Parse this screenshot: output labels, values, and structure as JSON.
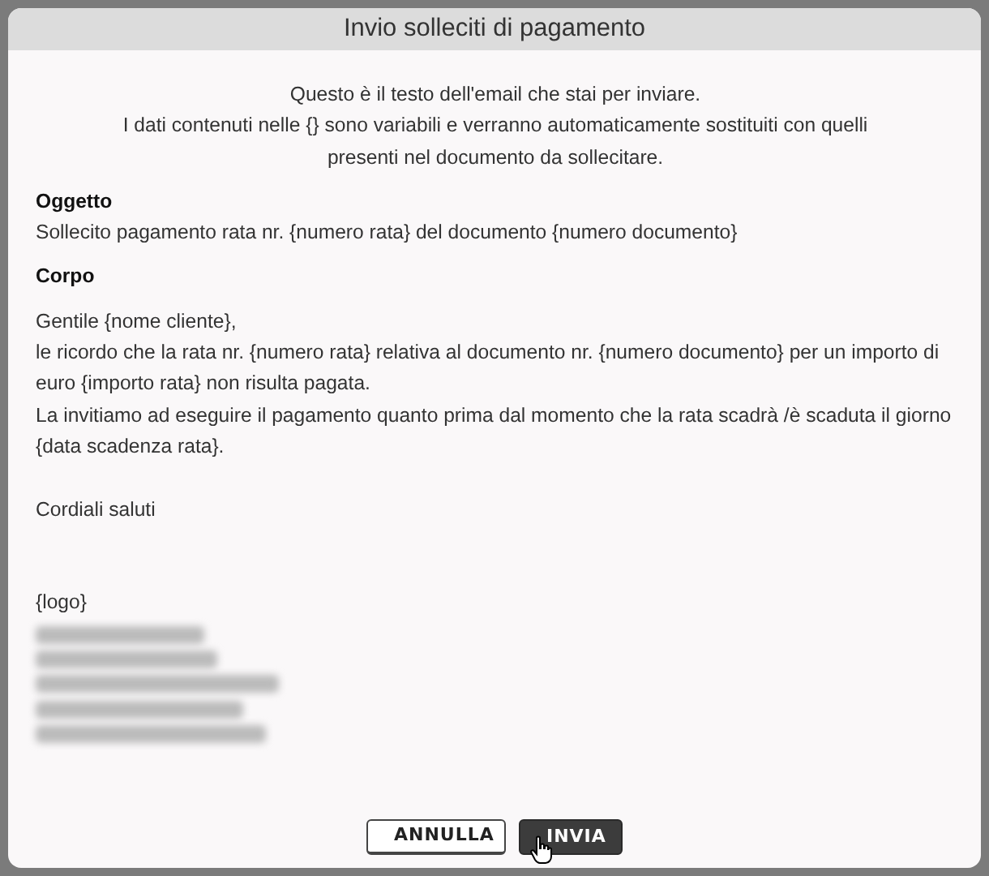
{
  "dialog": {
    "title": "Invio solleciti di pagamento",
    "intro": [
      "Questo è il testo dell'email che stai per inviare.",
      "I dati contenuti nelle {} sono variabili e verranno automaticamente sostituiti con quelli presenti nel documento da sollecitare."
    ],
    "subject_label": "Oggetto",
    "subject": "Sollecito pagamento rata nr. {numero rata} del documento {numero documento}",
    "body_label": "Corpo",
    "body": [
      {
        "kind": "line",
        "text": "Gentile {nome cliente},"
      },
      {
        "kind": "line",
        "text": "le ricordo che la rata nr. {numero rata} relativa al documento nr. {numero documento} per un importo di euro {importo rata} non risulta pagata."
      },
      {
        "kind": "line",
        "text": "La invitiamo ad eseguire il pagamento quanto prima dal momento che la rata scadrà /è scaduta il giorno {data scadenza rata}."
      },
      {
        "kind": "gap"
      },
      {
        "kind": "line",
        "text": "Cordiali saluti"
      },
      {
        "kind": "gap"
      },
      {
        "kind": "gap"
      },
      {
        "kind": "line",
        "text": "{logo}"
      },
      {
        "kind": "blurred"
      },
      {
        "kind": "blurred"
      },
      {
        "kind": "blurred"
      },
      {
        "kind": "blurred"
      },
      {
        "kind": "blurred"
      }
    ],
    "buttons": [
      {
        "label": "ANNULLA",
        "kind": "secondary"
      },
      {
        "label": "INVIA",
        "kind": "primary"
      }
    ]
  }
}
